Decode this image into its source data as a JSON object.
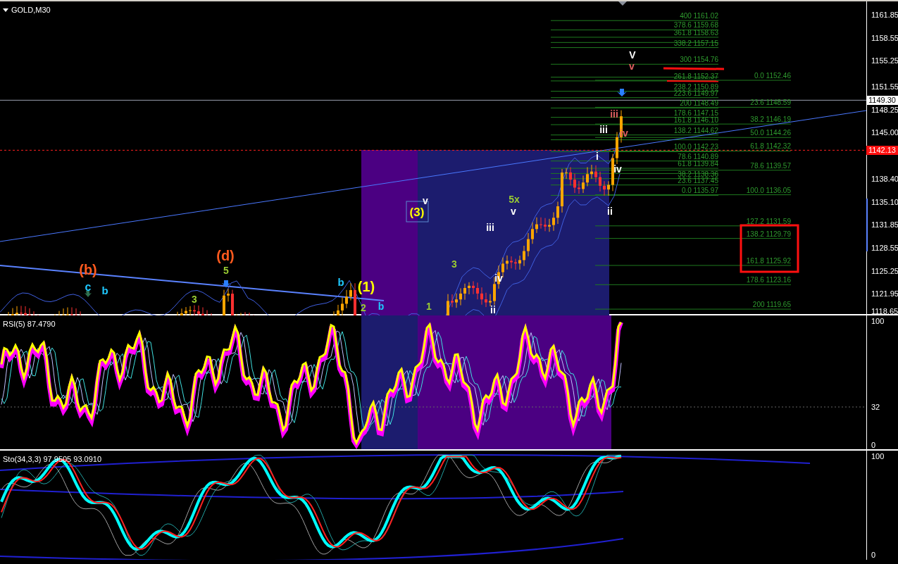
{
  "chart": {
    "title": "GOLD,M30",
    "price_axis": [
      "1161.85",
      "1158.55",
      "1155.25",
      "1151.55",
      "1148.25",
      "1145.00",
      "1138.40",
      "1135.10",
      "1131.85",
      "1128.55",
      "1125.25",
      "1121.95",
      "1118.65"
    ],
    "bid_tag": "1149.30",
    "alert_tag": "1142.13",
    "fib_left": [
      "400 1161.02",
      "378.6 1159.68",
      "361.8 1158.63",
      "338.2 1157.15",
      "300 1154.76",
      "261.8 1152.37",
      "238.2 1150.89",
      "223.6 1149.97",
      "200 1148.49",
      "178.6 1147.15",
      "161.8 1146.10",
      "138.2 1144.62",
      "100.0 1142.23",
      "78.6 1140.89",
      "61.8 1139.84",
      "38.2 1138.36",
      "23.6 1137.45",
      "0.0 1135.97"
    ],
    "fib_right": [
      "0.0 1152.46",
      "23.6 1148.59",
      "38.2 1146.19",
      "50.0 1144.26",
      "61.8 1142.32",
      "78.6 1139.57",
      "100.0 1136.05",
      "127.2 1131.59",
      "138.2 1129.79",
      "161.8 1125.92",
      "178.6 1123.16",
      "200 1119.65"
    ],
    "wave_labels": [
      {
        "text": "(b)",
        "color": "#ff5a1e"
      },
      {
        "text": "c",
        "color": "#1ec8ff"
      },
      {
        "text": "b",
        "color": "#1ec8ff"
      },
      {
        "text": "(d)",
        "color": "#ff5a1e"
      },
      {
        "text": "5",
        "color": "#9acd32"
      },
      {
        "text": "3",
        "color": "#9acd32"
      },
      {
        "text": "b",
        "color": "#1ec8ff"
      },
      {
        "text": "(1)",
        "color": "#ffff00"
      },
      {
        "text": "2",
        "color": "#9acd32"
      },
      {
        "text": "b",
        "color": "#1ec8ff"
      },
      {
        "text": "1",
        "color": "#9acd32"
      },
      {
        "text": "(3)",
        "color": "#ffff00"
      },
      {
        "text": "v",
        "color": "#ffffff"
      },
      {
        "text": "3",
        "color": "#9acd32"
      },
      {
        "text": "iii",
        "color": "#ffffff"
      },
      {
        "text": "iv",
        "color": "#ffffff"
      },
      {
        "text": "ii",
        "color": "#ffffff"
      },
      {
        "text": "5x",
        "color": "#9acd32"
      },
      {
        "text": "v",
        "color": "#ffffff"
      },
      {
        "text": "i",
        "color": "#ffffff"
      },
      {
        "text": "iii",
        "color": "#ffffff"
      },
      {
        "text": "ii",
        "color": "#ffffff"
      },
      {
        "text": "iv",
        "color": "#ffffff"
      },
      {
        "text": "iii",
        "color": "#e06060"
      },
      {
        "text": "iv",
        "color": "#e06060"
      },
      {
        "text": "V",
        "color": "#ffffff"
      },
      {
        "text": "v",
        "color": "#e06060"
      }
    ]
  },
  "rsi": {
    "title": "RSI(5) 87.4790",
    "axis": [
      "100",
      "32",
      "0"
    ]
  },
  "stochastic": {
    "title": "Sto(34,3,3) 97.9505 93.0910",
    "axis": [
      "100",
      "0"
    ]
  }
}
